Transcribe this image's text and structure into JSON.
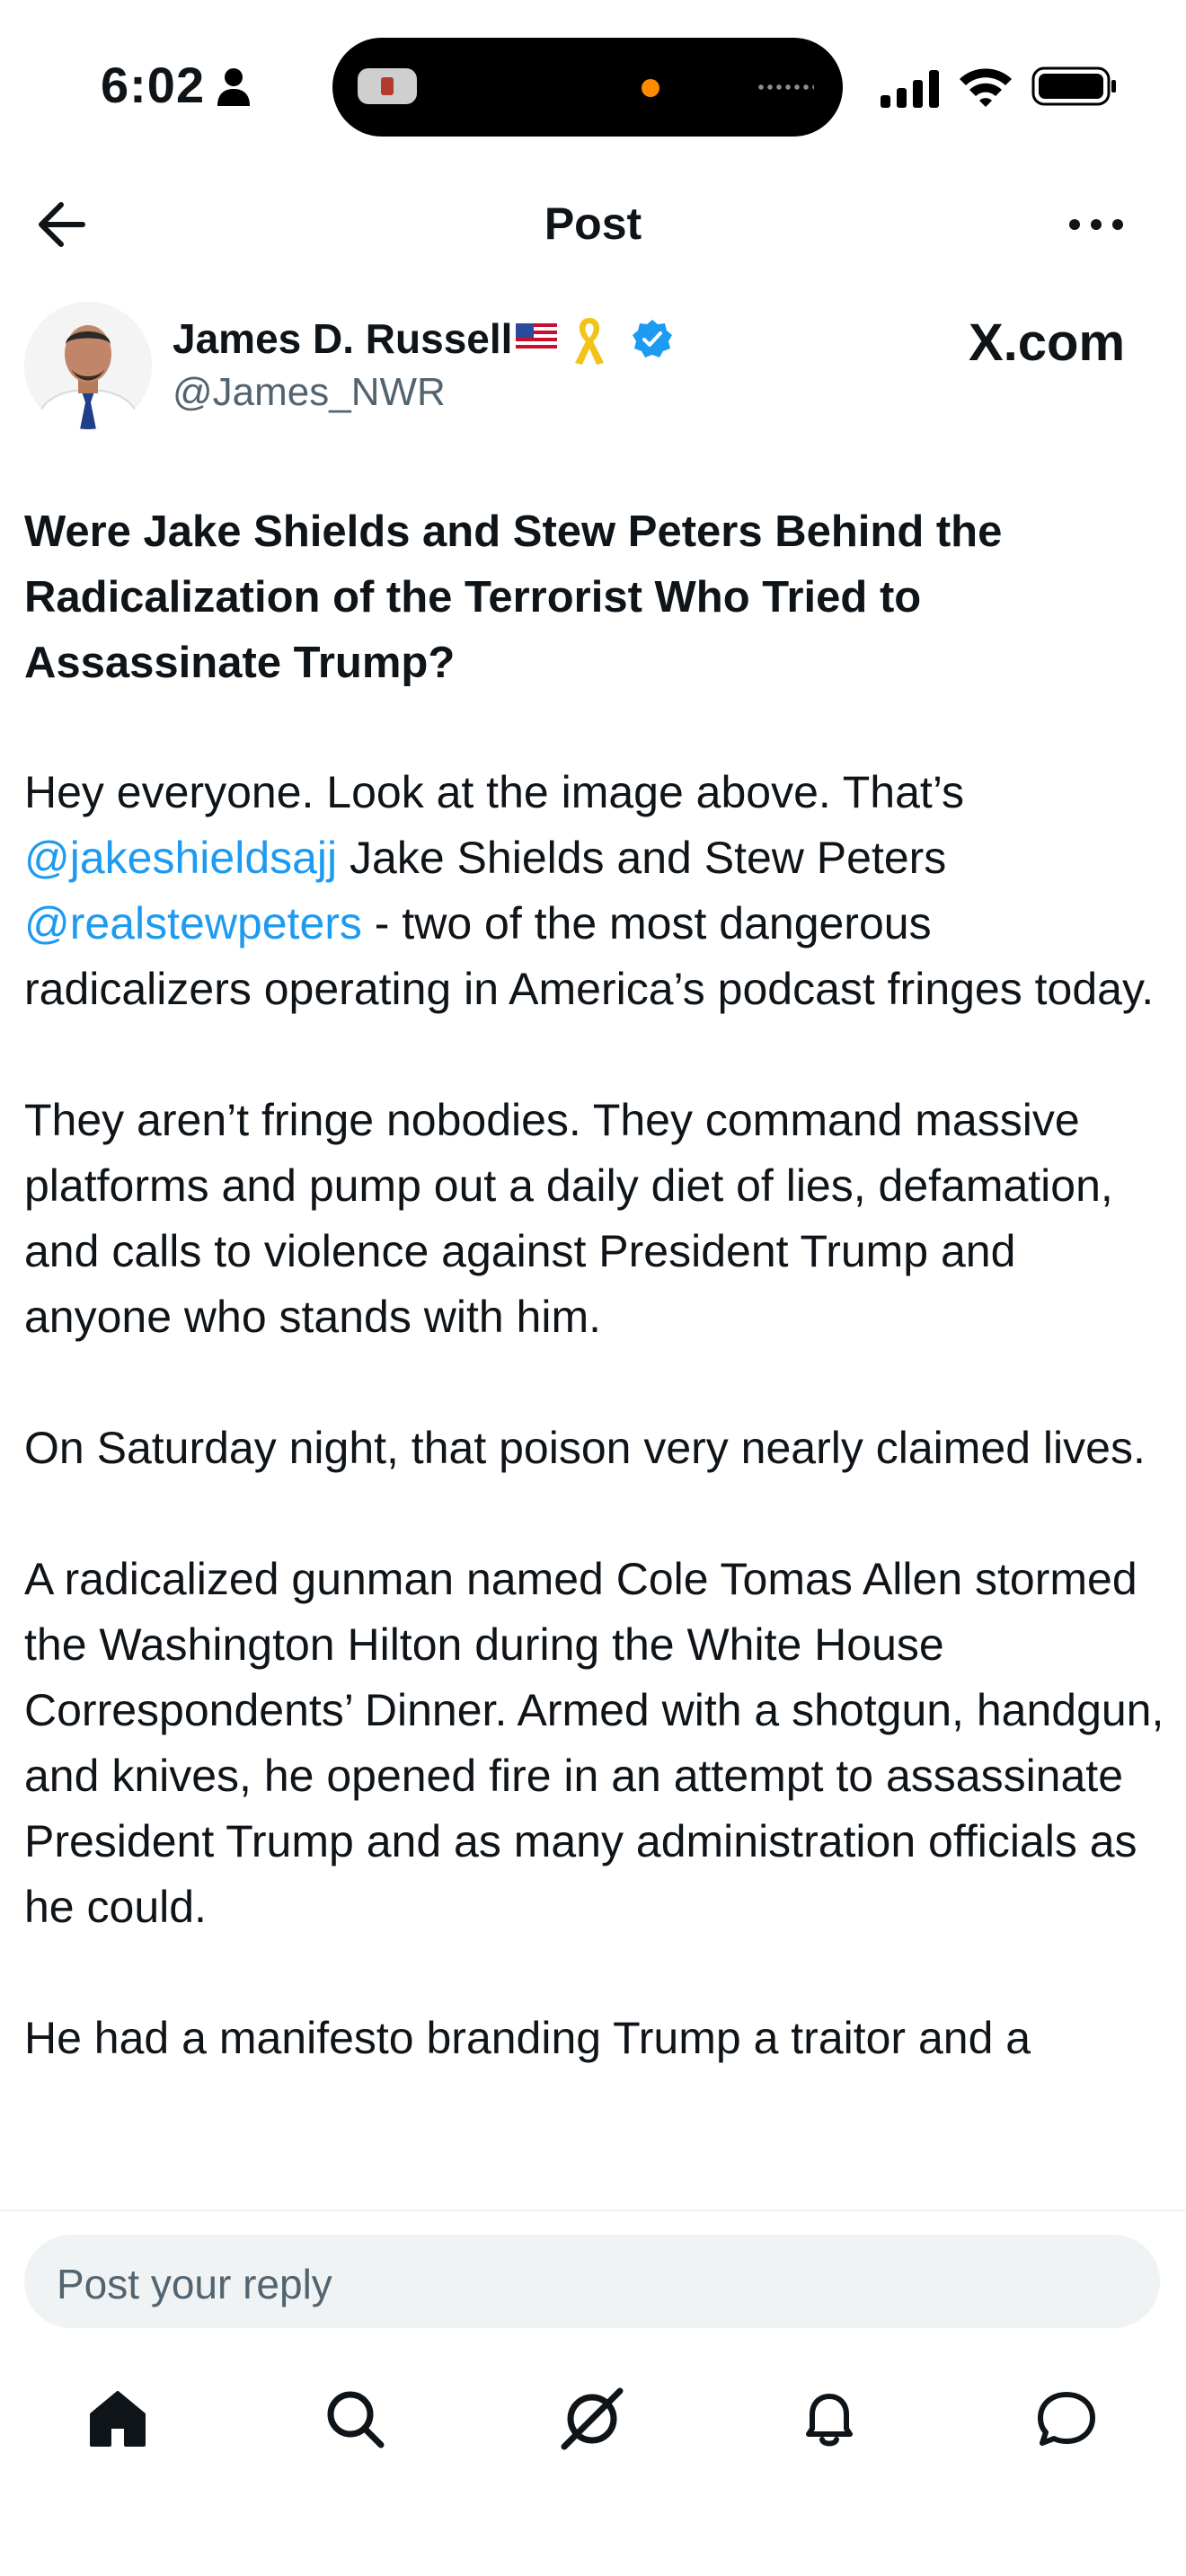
{
  "status_bar": {
    "time": "6:02"
  },
  "header": {
    "title": "Post"
  },
  "author": {
    "name": "James D. Russell",
    "handle": "@James_NWR",
    "site_label": "X.com"
  },
  "post": {
    "title": "Were Jake Shields and Stew Peters Behind the Radicalization of the Terrorist Who Tried to Assassinate Trump?",
    "p1": {
      "text_a": "Hey everyone. Look at the image above. That’s",
      "mention_1": "@jakeshieldsajj",
      "text_b": " Jake Shields and Stew Peters",
      "mention_2": "@realstewpeters",
      "text_c": "  - two of the most dangerous radicalizers operating in America’s podcast fringes today."
    },
    "p2": "They aren’t fringe nobodies. They command massive platforms and pump out a daily diet of lies, defamation, and calls to violence against President Trump and anyone who stands with him.",
    "p3": "On Saturday night, that poison very nearly claimed lives.",
    "p4": "A radicalized gunman named Cole Tomas Allen stormed the Washington Hilton during the White House Correspondents’ Dinner. Armed with a shotgun, handgun, and knives, he opened fire in an attempt to assassinate President Trump and as many administration officials as he could.",
    "p5": "He had a manifesto branding Trump a traitor and a"
  },
  "reply": {
    "placeholder": "Post your reply"
  },
  "tabs": [
    "home-icon",
    "search-icon",
    "grok-icon",
    "notifications-icon",
    "messages-icon"
  ],
  "colors": {
    "accent": "#1d9bf0",
    "secondary_text": "#536471",
    "input_bg": "#eff3f4"
  }
}
